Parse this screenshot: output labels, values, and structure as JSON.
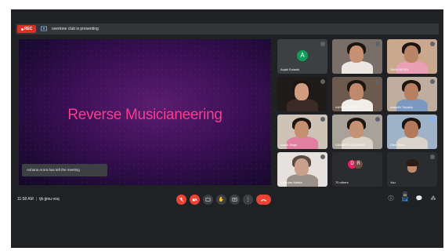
{
  "topbar": {
    "rec_label": "REC",
    "presenting_text": "overtone club is presenting"
  },
  "stage": {
    "slide_title": "Reverse Musicianeering",
    "toast": "Ashana Arora has left the meeting"
  },
  "participants": [
    {
      "name": "Anjali Solanki",
      "initial": "A"
    },
    {
      "name": "",
      "initial": ""
    },
    {
      "name": "SANA AFZAL",
      "initial": ""
    },
    {
      "name": "",
      "initial": ""
    },
    {
      "name": "AARIYA SHETTY",
      "initial": ""
    },
    {
      "name": "Aaradhi Tripathy",
      "initial": ""
    },
    {
      "name": "Aashi Singh",
      "initial": ""
    },
    {
      "name": "SAMARTHYA SINGH",
      "initial": ""
    },
    {
      "name": "Ram Sethi",
      "initial": ""
    },
    {
      "name": "Chandru Mehta",
      "initial": ""
    },
    {
      "name": "70 others",
      "initial": ""
    },
    {
      "name": "You",
      "initial": ""
    }
  ],
  "others_avatars": [
    "D",
    "R"
  ],
  "controls": {
    "time": "11:58 AM",
    "meeting_code": "tjk-jjmu-voq",
    "participant_count": "85"
  },
  "icons": {
    "mic": "mic-off-icon",
    "cam": "camera-off-icon",
    "captions": "captions-icon",
    "raise_hand": "raise-hand-icon",
    "present": "present-screen-icon",
    "more": "more-vert-icon",
    "end": "end-call-icon",
    "info": "info-icon",
    "people": "people-icon",
    "chat": "chat-icon",
    "activities": "activities-icon"
  }
}
